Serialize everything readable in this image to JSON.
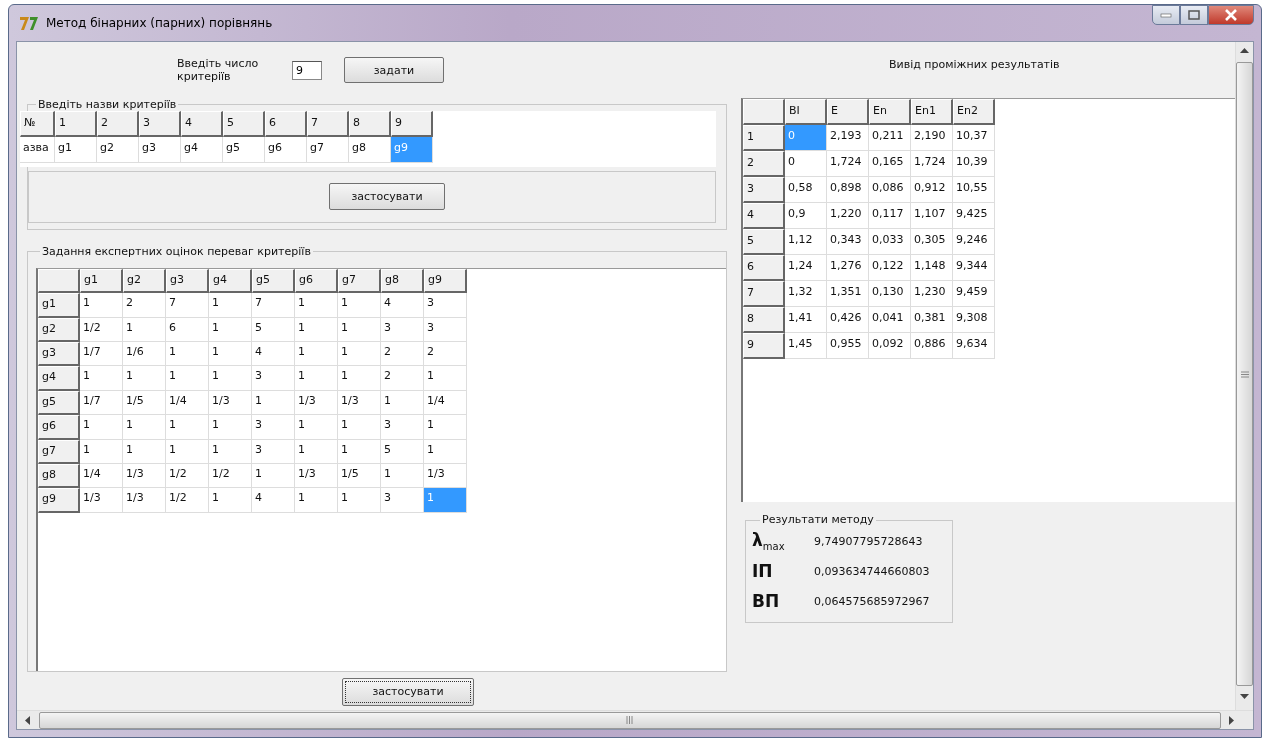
{
  "window": {
    "title": "Метод бінарних (парних) порівнянь"
  },
  "count": {
    "label": "Введіть число критеріїв",
    "value": "9"
  },
  "set_button": "задати",
  "names_group": {
    "title": "Введіть  назви критеріїв",
    "header_label": "№",
    "row_label": "азва",
    "columns": [
      {
        "number": "1",
        "name": "g1",
        "selected": false
      },
      {
        "number": "2",
        "name": "g2",
        "selected": false
      },
      {
        "number": "3",
        "name": "g3",
        "selected": false
      },
      {
        "number": "4",
        "name": "g4",
        "selected": false
      },
      {
        "number": "5",
        "name": "g5",
        "selected": false
      },
      {
        "number": "6",
        "name": "g6",
        "selected": false
      },
      {
        "number": "7",
        "name": "g7",
        "selected": false
      },
      {
        "number": "8",
        "name": "g8",
        "selected": false
      },
      {
        "number": "9",
        "name": "g9",
        "selected": true
      }
    ],
    "apply_button": "застосувати"
  },
  "matrix_group": {
    "title": "Задання експертних оцінок переваг критеріїв",
    "columns": [
      "g1",
      "g2",
      "g3",
      "g4",
      "g5",
      "g6",
      "g7",
      "g8",
      "g9"
    ],
    "rows": [
      {
        "header": "g1",
        "cells": [
          {
            "value": "1",
            "selected": false
          },
          {
            "value": "2",
            "selected": false
          },
          {
            "value": "7",
            "selected": false
          },
          {
            "value": "1",
            "selected": false
          },
          {
            "value": "7",
            "selected": false
          },
          {
            "value": "1",
            "selected": false
          },
          {
            "value": "1",
            "selected": false
          },
          {
            "value": "4",
            "selected": false
          },
          {
            "value": "3",
            "selected": false
          }
        ]
      },
      {
        "header": "g2",
        "cells": [
          {
            "value": "1/2",
            "selected": false
          },
          {
            "value": "1",
            "selected": false
          },
          {
            "value": "6",
            "selected": false
          },
          {
            "value": "1",
            "selected": false
          },
          {
            "value": "5",
            "selected": false
          },
          {
            "value": "1",
            "selected": false
          },
          {
            "value": "1",
            "selected": false
          },
          {
            "value": "3",
            "selected": false
          },
          {
            "value": "3",
            "selected": false
          }
        ]
      },
      {
        "header": "g3",
        "cells": [
          {
            "value": "1/7",
            "selected": false
          },
          {
            "value": "1/6",
            "selected": false
          },
          {
            "value": "1",
            "selected": false
          },
          {
            "value": "1",
            "selected": false
          },
          {
            "value": "4",
            "selected": false
          },
          {
            "value": "1",
            "selected": false
          },
          {
            "value": "1",
            "selected": false
          },
          {
            "value": "2",
            "selected": false
          },
          {
            "value": "2",
            "selected": false
          }
        ]
      },
      {
        "header": "g4",
        "cells": [
          {
            "value": "1",
            "selected": false
          },
          {
            "value": "1",
            "selected": false
          },
          {
            "value": "1",
            "selected": false
          },
          {
            "value": "1",
            "selected": false
          },
          {
            "value": "3",
            "selected": false
          },
          {
            "value": "1",
            "selected": false
          },
          {
            "value": "1",
            "selected": false
          },
          {
            "value": "2",
            "selected": false
          },
          {
            "value": "1",
            "selected": false
          }
        ]
      },
      {
        "header": "g5",
        "cells": [
          {
            "value": "1/7",
            "selected": false
          },
          {
            "value": "1/5",
            "selected": false
          },
          {
            "value": "1/4",
            "selected": false
          },
          {
            "value": "1/3",
            "selected": false
          },
          {
            "value": "1",
            "selected": false
          },
          {
            "value": "1/3",
            "selected": false
          },
          {
            "value": "1/3",
            "selected": false
          },
          {
            "value": "1",
            "selected": false
          },
          {
            "value": "1/4",
            "selected": false
          }
        ]
      },
      {
        "header": "g6",
        "cells": [
          {
            "value": "1",
            "selected": false
          },
          {
            "value": "1",
            "selected": false
          },
          {
            "value": "1",
            "selected": false
          },
          {
            "value": "1",
            "selected": false
          },
          {
            "value": "3",
            "selected": false
          },
          {
            "value": "1",
            "selected": false
          },
          {
            "value": "1",
            "selected": false
          },
          {
            "value": "3",
            "selected": false
          },
          {
            "value": "1",
            "selected": false
          }
        ]
      },
      {
        "header": "g7",
        "cells": [
          {
            "value": "1",
            "selected": false
          },
          {
            "value": "1",
            "selected": false
          },
          {
            "value": "1",
            "selected": false
          },
          {
            "value": "1",
            "selected": false
          },
          {
            "value": "3",
            "selected": false
          },
          {
            "value": "1",
            "selected": false
          },
          {
            "value": "1",
            "selected": false
          },
          {
            "value": "5",
            "selected": false
          },
          {
            "value": "1",
            "selected": false
          }
        ]
      },
      {
        "header": "g8",
        "cells": [
          {
            "value": "1/4",
            "selected": false
          },
          {
            "value": "1/3",
            "selected": false
          },
          {
            "value": "1/2",
            "selected": false
          },
          {
            "value": "1/2",
            "selected": false
          },
          {
            "value": "1",
            "selected": false
          },
          {
            "value": "1/3",
            "selected": false
          },
          {
            "value": "1/5",
            "selected": false
          },
          {
            "value": "1",
            "selected": false
          },
          {
            "value": "1/3",
            "selected": false
          }
        ]
      },
      {
        "header": "g9",
        "cells": [
          {
            "value": "1/3",
            "selected": false
          },
          {
            "value": "1/3",
            "selected": false
          },
          {
            "value": "1/2",
            "selected": false
          },
          {
            "value": "1",
            "selected": false
          },
          {
            "value": "4",
            "selected": false
          },
          {
            "value": "1",
            "selected": false
          },
          {
            "value": "1",
            "selected": false
          },
          {
            "value": "3",
            "selected": false
          },
          {
            "value": "1",
            "selected": true
          }
        ]
      }
    ],
    "apply_button": "застосувати"
  },
  "intermediate": {
    "title": "Вивід проміжних результатів",
    "columns": [
      "BI",
      "E",
      "En",
      "En1",
      "En2"
    ],
    "rows": [
      {
        "header": "1",
        "cells": [
          {
            "value": "0",
            "selected": true
          },
          {
            "value": "2,193",
            "selected": false
          },
          {
            "value": "0,211",
            "selected": false
          },
          {
            "value": "2,190",
            "selected": false
          },
          {
            "value": "10,37",
            "selected": false
          }
        ]
      },
      {
        "header": "2",
        "cells": [
          {
            "value": "0",
            "selected": false
          },
          {
            "value": "1,724",
            "selected": false
          },
          {
            "value": "0,165",
            "selected": false
          },
          {
            "value": "1,724",
            "selected": false
          },
          {
            "value": "10,39",
            "selected": false
          }
        ]
      },
      {
        "header": "3",
        "cells": [
          {
            "value": "0,58",
            "selected": false
          },
          {
            "value": "0,898",
            "selected": false
          },
          {
            "value": "0,086",
            "selected": false
          },
          {
            "value": "0,912",
            "selected": false
          },
          {
            "value": "10,55",
            "selected": false
          }
        ]
      },
      {
        "header": "4",
        "cells": [
          {
            "value": "0,9",
            "selected": false
          },
          {
            "value": "1,220",
            "selected": false
          },
          {
            "value": "0,117",
            "selected": false
          },
          {
            "value": "1,107",
            "selected": false
          },
          {
            "value": "9,425",
            "selected": false
          }
        ]
      },
      {
        "header": "5",
        "cells": [
          {
            "value": "1,12",
            "selected": false
          },
          {
            "value": "0,343",
            "selected": false
          },
          {
            "value": "0,033",
            "selected": false
          },
          {
            "value": "0,305",
            "selected": false
          },
          {
            "value": "9,246",
            "selected": false
          }
        ]
      },
      {
        "header": "6",
        "cells": [
          {
            "value": "1,24",
            "selected": false
          },
          {
            "value": "1,276",
            "selected": false
          },
          {
            "value": "0,122",
            "selected": false
          },
          {
            "value": "1,148",
            "selected": false
          },
          {
            "value": "9,344",
            "selected": false
          }
        ]
      },
      {
        "header": "7",
        "cells": [
          {
            "value": "1,32",
            "selected": false
          },
          {
            "value": "1,351",
            "selected": false
          },
          {
            "value": "0,130",
            "selected": false
          },
          {
            "value": "1,230",
            "selected": false
          },
          {
            "value": "9,459",
            "selected": false
          }
        ]
      },
      {
        "header": "8",
        "cells": [
          {
            "value": "1,41",
            "selected": false
          },
          {
            "value": "0,426",
            "selected": false
          },
          {
            "value": "0,041",
            "selected": false
          },
          {
            "value": "0,381",
            "selected": false
          },
          {
            "value": "9,308",
            "selected": false
          }
        ]
      },
      {
        "header": "9",
        "cells": [
          {
            "value": "1,45",
            "selected": false
          },
          {
            "value": "0,955",
            "selected": false
          },
          {
            "value": "0,092",
            "selected": false
          },
          {
            "value": "0,886",
            "selected": false
          },
          {
            "value": "9,634",
            "selected": false
          }
        ]
      }
    ]
  },
  "results": {
    "title": "Результати методу",
    "items": [
      {
        "label": "λ$_{max}$",
        "value": "9,74907795728643"
      },
      {
        "label": "ІП",
        "value": "0,093634744660803"
      },
      {
        "label": "ВП",
        "value": "0,064575685972967"
      }
    ]
  }
}
